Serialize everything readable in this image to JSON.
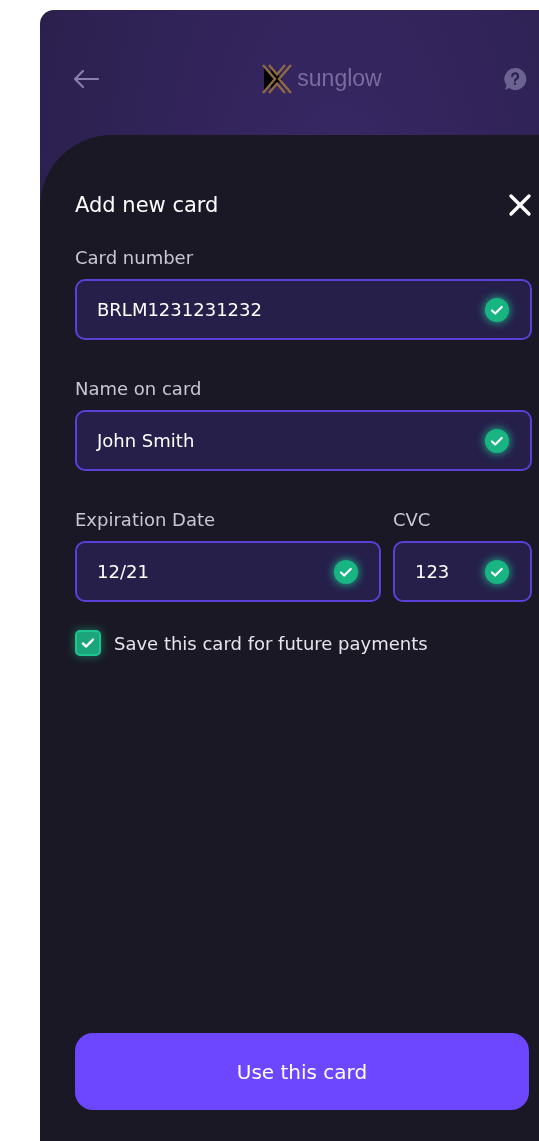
{
  "header": {
    "logo_text": "sunglow"
  },
  "sheet": {
    "title": "Add new card",
    "rows": [
      {
        "fields": [
          {
            "label": "Card number",
            "value": "BRLM1231231232",
            "valid": true
          }
        ]
      },
      {
        "fields": [
          {
            "label": "Name on card",
            "value": "John Smith",
            "valid": true
          }
        ]
      },
      {
        "fields": [
          {
            "label": "Expiration Date",
            "value": "12/21",
            "valid": true
          },
          {
            "label": "CVC",
            "value": "123",
            "valid": true
          }
        ]
      }
    ],
    "save_card": {
      "label": "Save this card for future payments",
      "checked": true
    },
    "submit": {
      "label": "Use this card"
    }
  }
}
